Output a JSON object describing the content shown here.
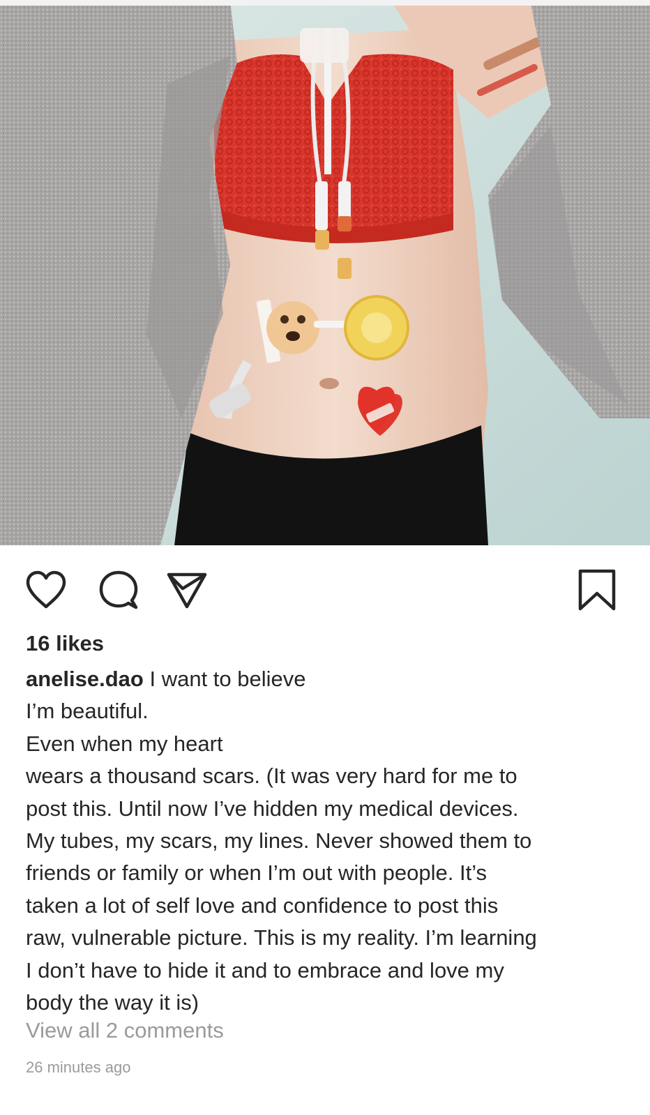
{
  "post": {
    "image": {
      "subject": "torso-with-medical-devices",
      "colors": {
        "background": "#cfe0de",
        "cardigan": "#a9a6a6",
        "top": "#d8362c",
        "skin": "#efd3c2",
        "pants": "#111111"
      }
    },
    "actions": {
      "like_icon": "heart-outline-icon",
      "comment_icon": "speech-bubble-icon",
      "share_icon": "paper-plane-icon",
      "save_icon": "bookmark-icon"
    },
    "likes": "16 likes",
    "username": "anelise.dao",
    "caption_lines": [
      " I want to believe",
      "I’m beautiful.",
      "Even when my heart",
      "wears a thousand scars. (It was very hard for me to",
      "post this. Until now I’ve hidden my medical devices.",
      "My tubes, my scars, my lines. Never showed them to",
      "friends or family or when I’m out with people. It’s",
      "taken a lot of self love and confidence to post this",
      "raw, vulnerable picture. This is my reality. I’m learning",
      "I don’t have to hide it and to embrace and love my",
      "body the way it is)"
    ],
    "view_comments": "View all 2 comments",
    "timestamp": "26 minutes ago"
  }
}
